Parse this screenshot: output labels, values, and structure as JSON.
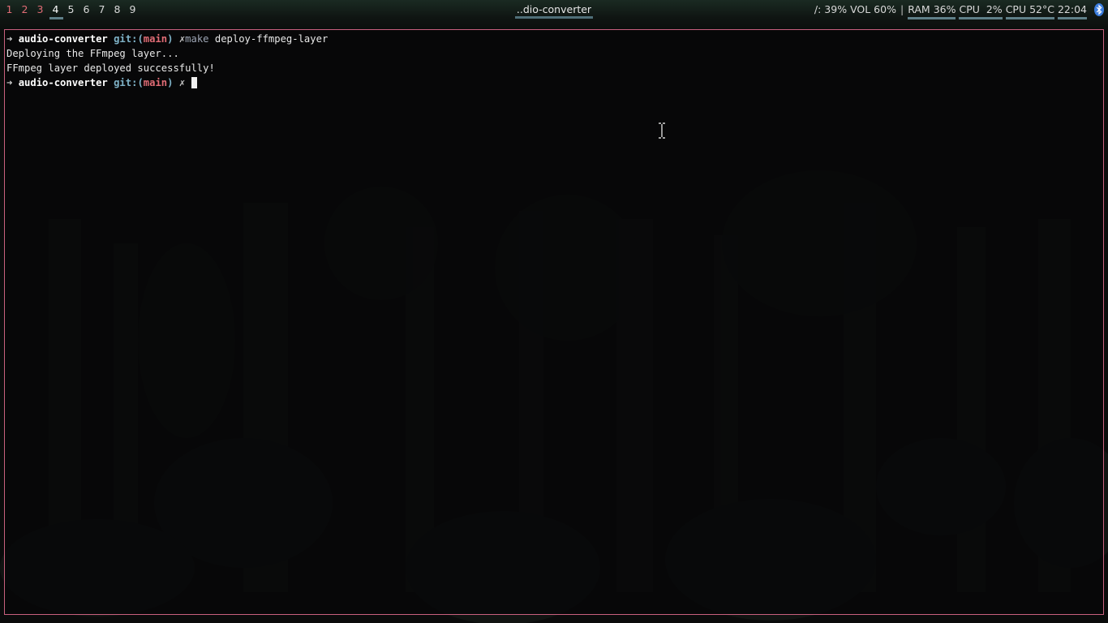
{
  "topbar": {
    "workspaces": [
      {
        "label": "1",
        "state": "urgent"
      },
      {
        "label": "2",
        "state": "urgent"
      },
      {
        "label": "3",
        "state": "urgent"
      },
      {
        "label": "4",
        "state": "focused"
      },
      {
        "label": "5",
        "state": "normal"
      },
      {
        "label": "6",
        "state": "normal"
      },
      {
        "label": "7",
        "state": "normal"
      },
      {
        "label": "8",
        "state": "normal"
      },
      {
        "label": "9",
        "state": "normal"
      }
    ],
    "window_title": "..dio-converter",
    "status": {
      "disk": "/: 39%",
      "volume": "VOL 60%",
      "separator": "|",
      "ram": "RAM 36%",
      "cpu_usage": "CPU  2%",
      "cpu_temp": "CPU 52°C",
      "clock": "22:04"
    },
    "icons": {
      "bluetooth": "bluetooth-icon"
    },
    "colors": {
      "urgent": "#e06c75",
      "accent_underline": "#5f7f88"
    }
  },
  "terminal": {
    "border_color": "#c8607e",
    "lines": [
      {
        "type": "prompt",
        "arrow": "➜",
        "dir": "audio-converter",
        "git_label": "git:(",
        "branch": "main",
        "git_close": ")",
        "dirty_mark": "✗",
        "command_name": "make",
        "command_args": " deploy-ffmpeg-layer"
      },
      {
        "type": "output",
        "text": "Deploying the FFmpeg layer..."
      },
      {
        "type": "output",
        "text": "FFmpeg layer deployed successfully!"
      },
      {
        "type": "prompt",
        "arrow": "➜",
        "dir": "audio-converter",
        "git_label": "git:(",
        "branch": "main",
        "git_close": ")",
        "dirty_mark": "✗",
        "command_name": "",
        "command_args": ""
      }
    ]
  }
}
